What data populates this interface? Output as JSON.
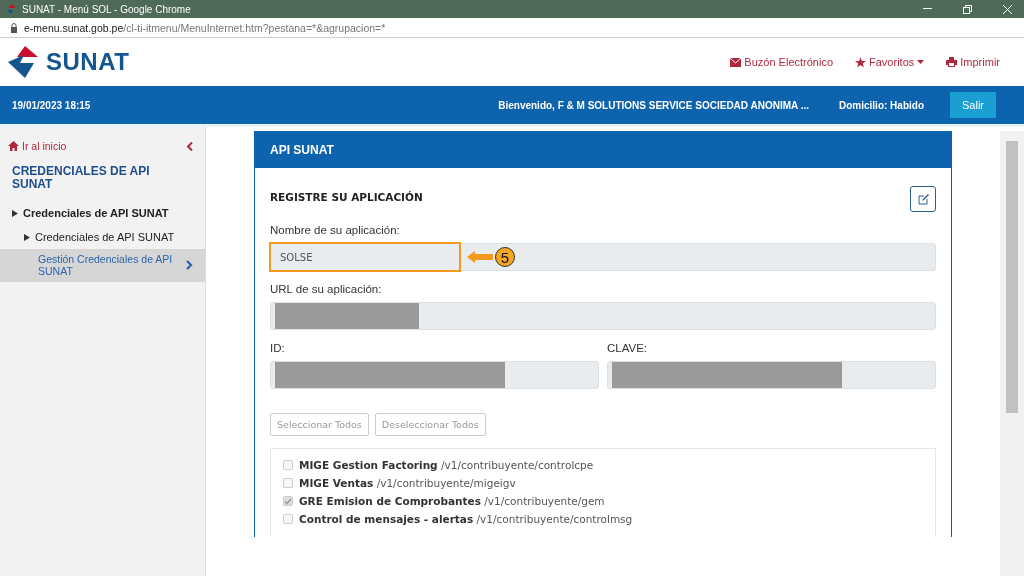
{
  "window": {
    "title": "SUNAT - Menú SOL - Google Chrome",
    "url_host": "e-menu.sunat.gob.pe",
    "url_path": "/cl-ti-itmenu/MenuInternet.htm?pestana=*&agrupacion=*"
  },
  "header": {
    "logo": "SUNAT",
    "links": [
      {
        "kind": "mail",
        "label": "Buzón Electrónico"
      },
      {
        "kind": "star",
        "label": "Favoritos",
        "dropdown": true
      },
      {
        "kind": "print",
        "label": "Imprimir"
      }
    ]
  },
  "topbar": {
    "datetime": "19/01/2023 18:15",
    "welcome": "Bienvenido, F & M SOLUTIONS SERVICE SOCIEDAD ANONIMA ...",
    "domicilio": "Domicilio: Habido",
    "logout": "Salir"
  },
  "sidebar": {
    "home": "Ir al inicio",
    "section": "CREDENCIALES DE API SUNAT",
    "items": [
      {
        "label": "Credenciales de API SUNAT",
        "selected": false,
        "children": [
          {
            "label": "Credenciales de API SUNAT",
            "selected": false,
            "children": [
              {
                "label": "Gestión Credenciales de API SUNAT",
                "selected": true
              }
            ]
          }
        ]
      }
    ]
  },
  "panel": {
    "title": "API SUNAT",
    "subtitle": "REGISTRE SU APLICACIÓN",
    "fields": [
      {
        "label": "Nombre de su aplicación:",
        "value": "SOLSE",
        "highlighted": true
      },
      {
        "label": "URL de su aplicación:",
        "redacted": true
      }
    ],
    "pair": [
      {
        "label": "ID:",
        "redacted": true
      },
      {
        "label": "CLAVE:",
        "redacted": true
      }
    ],
    "annotation": {
      "number": "5"
    },
    "buttons": [
      "Seleccionar Todos",
      "Deseleccionar Todos"
    ],
    "apis": [
      {
        "name": "MIGE Gestion Factoring",
        "path": "/v1/contribuyente/controlcpe",
        "checked": false
      },
      {
        "name": "MIGE Ventas",
        "path": "/v1/contribuyente/migeigv",
        "checked": false
      },
      {
        "name": "GRE Emision de Comprobantes",
        "path": "/v1/contribuyente/gem",
        "checked": true
      },
      {
        "name": "Control de mensajes - alertas",
        "path": "/v1/contribuyente/controlmsg",
        "checked": false
      }
    ]
  }
}
